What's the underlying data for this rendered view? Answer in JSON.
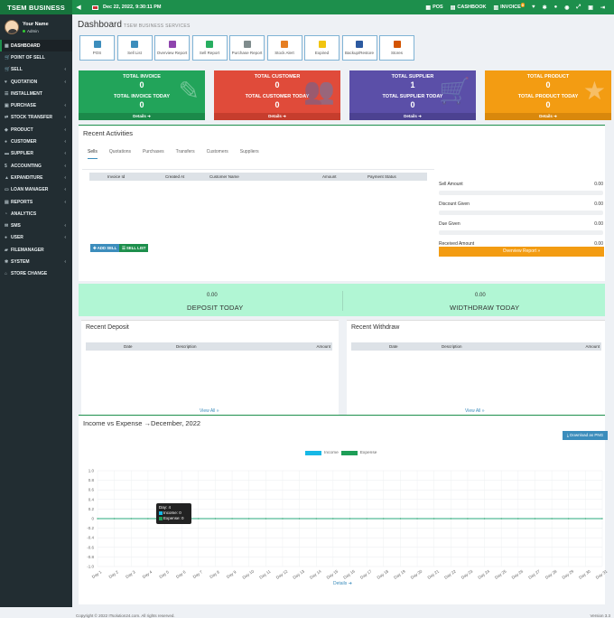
{
  "app": {
    "brand": "TSEM BUSINESS",
    "date": "Dec 22, 2022, 9:30:11 PM"
  },
  "topbar": {
    "pos_label": "POS",
    "cashbook_label": "CASHBOOK",
    "invoice_label": "INVOICE",
    "invoice_badge": "0"
  },
  "user": {
    "name": "Your Name",
    "role": "Admin"
  },
  "sidebar": {
    "items": [
      {
        "label": "DASHBOARD",
        "icon": "dashboard-icon",
        "chev": ""
      },
      {
        "label": "POINT OF SELL",
        "icon": "cart-icon",
        "chev": ""
      },
      {
        "label": "SELL",
        "icon": "cart-icon",
        "chev": "‹"
      },
      {
        "label": "QUOTATION",
        "icon": "heart-icon",
        "chev": "‹"
      },
      {
        "label": "INSTALLMENT",
        "icon": "list-icon",
        "chev": ""
      },
      {
        "label": "PURCHASE",
        "icon": "bag-icon",
        "chev": "‹"
      },
      {
        "label": "STOCK TRANSFER",
        "icon": "transfer-icon",
        "chev": "‹"
      },
      {
        "label": "PRODUCT",
        "icon": "cube-icon",
        "chev": "‹"
      },
      {
        "label": "CUSTOMER",
        "icon": "users-icon",
        "chev": "‹"
      },
      {
        "label": "SUPPLIER",
        "icon": "truck-icon",
        "chev": "‹"
      },
      {
        "label": "ACCOUNTING",
        "icon": "money-icon",
        "chev": "‹"
      },
      {
        "label": "EXPANDITURE",
        "icon": "chart-icon",
        "chev": "‹"
      },
      {
        "label": "LOAN MANAGER",
        "icon": "wallet-icon",
        "chev": "‹"
      },
      {
        "label": "REPORTS",
        "icon": "file-icon",
        "chev": "‹"
      },
      {
        "label": "ANALYTICS",
        "icon": "analytics-icon",
        "chev": ""
      },
      {
        "label": "SMS",
        "icon": "sms-icon",
        "chev": "‹"
      },
      {
        "label": "USER",
        "icon": "user-icon",
        "chev": "‹"
      },
      {
        "label": "FILEMANAGER",
        "icon": "folder-icon",
        "chev": ""
      },
      {
        "label": "SYSTEM",
        "icon": "gear-icon",
        "chev": "‹"
      },
      {
        "label": "STORE CHANGE",
        "icon": "store-icon",
        "chev": ""
      }
    ]
  },
  "page": {
    "title": "Dashboard",
    "subtitle": "TSEM BUSINESS SERVICES"
  },
  "quick_links": [
    {
      "label": "POS",
      "color": "#3c8dbc"
    },
    {
      "label": "Sell List",
      "color": "#3c8dbc"
    },
    {
      "label": "Overview Report",
      "color": "#8e44ad"
    },
    {
      "label": "Sell Report",
      "color": "#27ae60"
    },
    {
      "label": "Purchase Report",
      "color": "#7f8c8d"
    },
    {
      "label": "Stock Alert",
      "color": "#e67e22"
    },
    {
      "label": "Expired",
      "color": "#f1c40f"
    },
    {
      "label": "Backup/Restore",
      "color": "#2c5aa0"
    },
    {
      "label": "Stores",
      "color": "#d35400"
    }
  ],
  "stats": [
    {
      "label1": "TOTAL INVOICE",
      "value1": "0",
      "label2": "TOTAL INVOICE TODAY",
      "value2": "0",
      "details": "Details",
      "color": "#22a45a",
      "foot": "#1b8a4a",
      "icon": "✎"
    },
    {
      "label1": "TOTAL CUSTOMER",
      "value1": "0",
      "label2": "TOTAL CUSTOMER TODAY",
      "value2": "0",
      "details": "Details",
      "color": "#e04b3a",
      "foot": "#c63d2d",
      "icon": "👥"
    },
    {
      "label1": "TOTAL SUPPLIER",
      "value1": "1",
      "label2": "TOTAL SUPPLIER TODAY",
      "value2": "0",
      "details": "Details",
      "color": "#5b4fa8",
      "foot": "#4c4291",
      "icon": "🛒"
    },
    {
      "label1": "TOTAL PRODUCT",
      "value1": "0",
      "label2": "TOTAL PRODUCT TODAY",
      "value2": "0",
      "details": "Details",
      "color": "#f39c12",
      "foot": "#d9880c",
      "icon": "★"
    }
  ],
  "activities": {
    "title": "Recent Activities",
    "tabs": [
      "Sells",
      "Quotations",
      "Purchases",
      "Transfers",
      "Customers",
      "Suppliers"
    ],
    "columns": [
      "Invoice Id",
      "Created At",
      "Customer Name",
      "Amount",
      "Payment Status"
    ],
    "add_sell": "ADD SELL",
    "sell_list": "SELL LIST",
    "summary": [
      {
        "label": "Sell Amount",
        "value": "0.00"
      },
      {
        "label": "Discount Given",
        "value": "0.00"
      },
      {
        "label": "Due Given",
        "value": "0.00"
      },
      {
        "label": "Received Amount",
        "value": "0.00"
      }
    ],
    "overview_btn": "Overview Report »"
  },
  "today": {
    "deposit_value": "0.00",
    "deposit_label": "DEPOSIT TODAY",
    "withdraw_value": "0.00",
    "withdraw_label": "WIDTHDRAW TODAY"
  },
  "recent_deposit": {
    "title": "Recent Deposit",
    "columns": [
      "Date",
      "Description",
      "Amount"
    ],
    "view_all": "View All »"
  },
  "recent_withdraw": {
    "title": "Recent Withdraw",
    "columns": [
      "Date",
      "Description",
      "Amount"
    ],
    "view_all": "View All »"
  },
  "chart_section": {
    "title": "Income vs Expense →December, 2022",
    "download": "Download as PNG",
    "details": "Details"
  },
  "chart_data": {
    "type": "line",
    "x": [
      "Day 1",
      "Day 2",
      "Day 3",
      "Day 4",
      "Day 5",
      "Day 6",
      "Day 7",
      "Day 8",
      "Day 9",
      "Day 10",
      "Day 11",
      "Day 12",
      "Day 13",
      "Day 14",
      "Day 15",
      "Day 16",
      "Day 17",
      "Day 18",
      "Day 19",
      "Day 20",
      "Day 21",
      "Day 22",
      "Day 23",
      "Day 24",
      "Day 25",
      "Day 26",
      "Day 27",
      "Day 28",
      "Day 29",
      "Day 30",
      "Day 31"
    ],
    "series": [
      {
        "name": "Income",
        "color": "#17b8e6",
        "values": [
          0,
          0,
          0,
          0,
          0,
          0,
          0,
          0,
          0,
          0,
          0,
          0,
          0,
          0,
          0,
          0,
          0,
          0,
          0,
          0,
          0,
          0,
          0,
          0,
          0,
          0,
          0,
          0,
          0,
          0,
          0
        ]
      },
      {
        "name": "Expense",
        "color": "#1d9e57",
        "values": [
          0,
          0,
          0,
          0,
          0,
          0,
          0,
          0,
          0,
          0,
          0,
          0,
          0,
          0,
          0,
          0,
          0,
          0,
          0,
          0,
          0,
          0,
          0,
          0,
          0,
          0,
          0,
          0,
          0,
          0,
          0
        ]
      }
    ],
    "ylim": [
      -1.0,
      1.0
    ],
    "yticks": [
      "1.0",
      "0.8",
      "0.6",
      "0.4",
      "0.2",
      "0",
      "-0.2",
      "-0.4",
      "-0.6",
      "-0.8",
      "-1.0"
    ],
    "legend": "top-center",
    "tooltip": {
      "title": "Day: 4",
      "income": "Income: 0",
      "expense": "Expense: 0"
    }
  },
  "footer": {
    "copyright": "Copyright © 2022 ITsolution24.com. All rights reserved.",
    "version": "Version 3.3"
  }
}
